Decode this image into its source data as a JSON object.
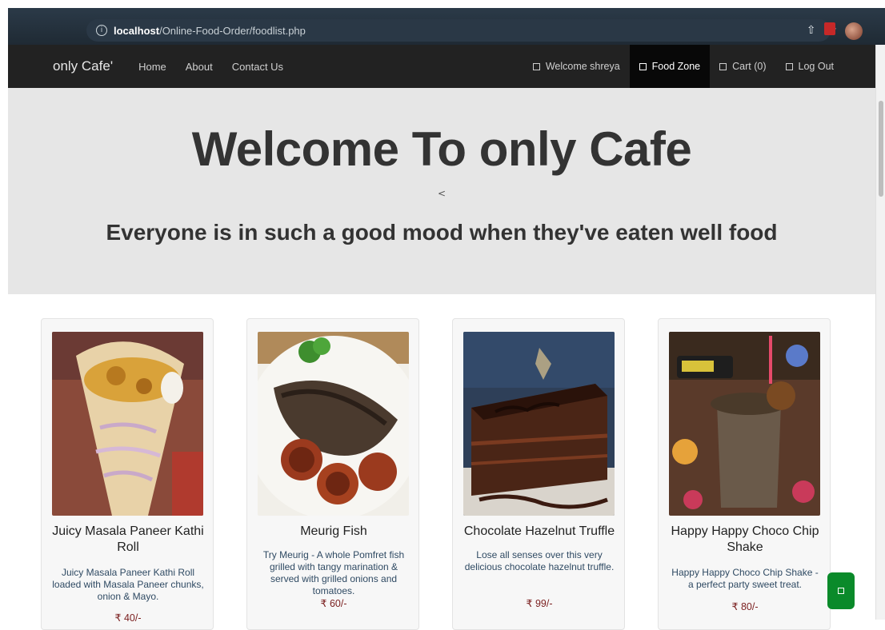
{
  "browser": {
    "url_host": "localhost",
    "url_path": "/Online-Food-Order/foodlist.php",
    "icons": [
      "info-icon",
      "share-icon",
      "star-icon"
    ]
  },
  "navbar": {
    "brand": "only Cafe'",
    "links": [
      "Home",
      "About",
      "Contact Us"
    ],
    "right": {
      "welcome": "Welcome shreya",
      "food_zone": "Food Zone",
      "cart": "Cart (0)",
      "logout": "Log Out"
    }
  },
  "jumbotron": {
    "title": "Welcome To only Cafe",
    "caret": "<",
    "subtitle": "Everyone is in such a good mood when they've eaten well food"
  },
  "cards": [
    {
      "title": "Juicy Masala Paneer Kathi Roll",
      "desc": "Juicy Masala Paneer Kathi Roll loaded with Masala Paneer chunks, onion & Mayo.",
      "price": "₹ 40/-"
    },
    {
      "title": "Meurig Fish",
      "desc": "Try Meurig - A whole Pomfret fish grilled with tangy marination & served with grilled onions and tomatoes.",
      "price": "₹ 60/-"
    },
    {
      "title": "Chocolate Hazelnut Truffle",
      "desc": "Lose all senses over this very delicious chocolate hazelnut truffle.",
      "price": "₹ 99/-"
    },
    {
      "title": "Happy Happy Choco Chip Shake",
      "desc": "Happy Happy Choco Chip Shake - a perfect party sweet treat.",
      "price": "₹ 80/-"
    }
  ],
  "colors": {
    "navbar_bg": "#222222",
    "jumbotron_bg": "#e6e6e6",
    "price": "#7a1e1e",
    "desc": "#2f4a63",
    "float_button": "#0a8a2a"
  }
}
